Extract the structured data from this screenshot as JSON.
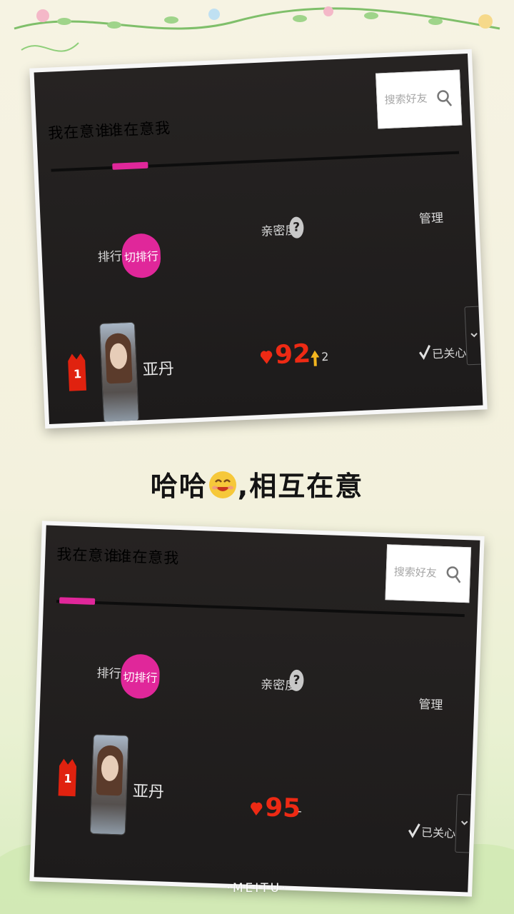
{
  "colors": {
    "accent": "#e0279a",
    "score": "#ee2a14",
    "screen_bg": "#1d1b1b"
  },
  "screens": [
    {
      "tabs": [
        {
          "label": "我在意谁",
          "active": true
        },
        {
          "label": "谁在意我",
          "active": false
        }
      ],
      "search": {
        "placeholder": "搜索好友"
      },
      "columns": {
        "rank": "排行",
        "switch": "切排行",
        "closeness": "亲密度",
        "manage": "管理"
      },
      "entry": {
        "rank": "1",
        "name": "亚丹",
        "score": "92",
        "trend": "2",
        "follow_status": "已关心"
      }
    },
    {
      "tabs": [
        {
          "label": "我在意谁",
          "active": false
        },
        {
          "label": "谁在意我",
          "active": true
        }
      ],
      "search": {
        "placeholder": "搜索好友"
      },
      "columns": {
        "rank": "排行",
        "switch": "切排行",
        "closeness": "亲密度",
        "manage": "管理"
      },
      "entry": {
        "rank": "1",
        "name": "亚丹",
        "score": "95",
        "trend": "-",
        "follow_status": "已关心"
      }
    }
  ],
  "caption": {
    "text_before": "哈哈",
    "emoji": "smiling-face",
    "text_after": ",相互在意"
  },
  "watermark": "·MEITU·"
}
